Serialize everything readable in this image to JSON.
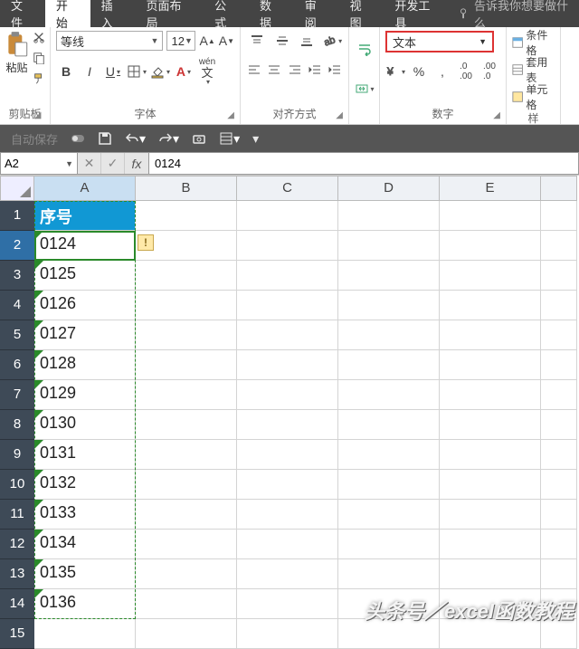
{
  "tabs": {
    "items": [
      "文件",
      "开始",
      "插入",
      "页面布局",
      "公式",
      "数据",
      "审阅",
      "视图",
      "开发工具"
    ],
    "active_index": 1,
    "tell_me": "告诉我你想要做什么"
  },
  "ribbon": {
    "clipboard": {
      "paste": "粘贴",
      "label": "剪贴板"
    },
    "font": {
      "name": "等线",
      "size": "12",
      "bold": "B",
      "italic": "I",
      "underline": "U",
      "wen": "wén",
      "label": "字体"
    },
    "align": {
      "label": "对齐方式"
    },
    "number": {
      "format": "文本",
      "percent": "%",
      "thousands": ",",
      "inc": "+.0",
      "dec": ".00",
      "label": "数字"
    },
    "styles": {
      "cond": "条件格",
      "fmt_table": "套用表",
      "cell_style": "单元格",
      "label": "样"
    }
  },
  "qat": {
    "auto_label": "自动保存"
  },
  "fx": {
    "name": "A2",
    "value": "0124"
  },
  "grid": {
    "columns": [
      "A",
      "B",
      "C",
      "D",
      "E"
    ],
    "rows": [
      {
        "n": "1",
        "a": "序号",
        "header": true
      },
      {
        "n": "2",
        "a": "0124",
        "sel": true
      },
      {
        "n": "3",
        "a": "0125"
      },
      {
        "n": "4",
        "a": "0126"
      },
      {
        "n": "5",
        "a": "0127"
      },
      {
        "n": "6",
        "a": "0128"
      },
      {
        "n": "7",
        "a": "0129"
      },
      {
        "n": "8",
        "a": "0130"
      },
      {
        "n": "9",
        "a": "0131"
      },
      {
        "n": "10",
        "a": "0132"
      },
      {
        "n": "11",
        "a": "0133"
      },
      {
        "n": "12",
        "a": "0134"
      },
      {
        "n": "13",
        "a": "0135"
      },
      {
        "n": "14",
        "a": "0136"
      },
      {
        "n": "15",
        "a": ""
      }
    ]
  },
  "watermark": "头条号／excel函数教程"
}
